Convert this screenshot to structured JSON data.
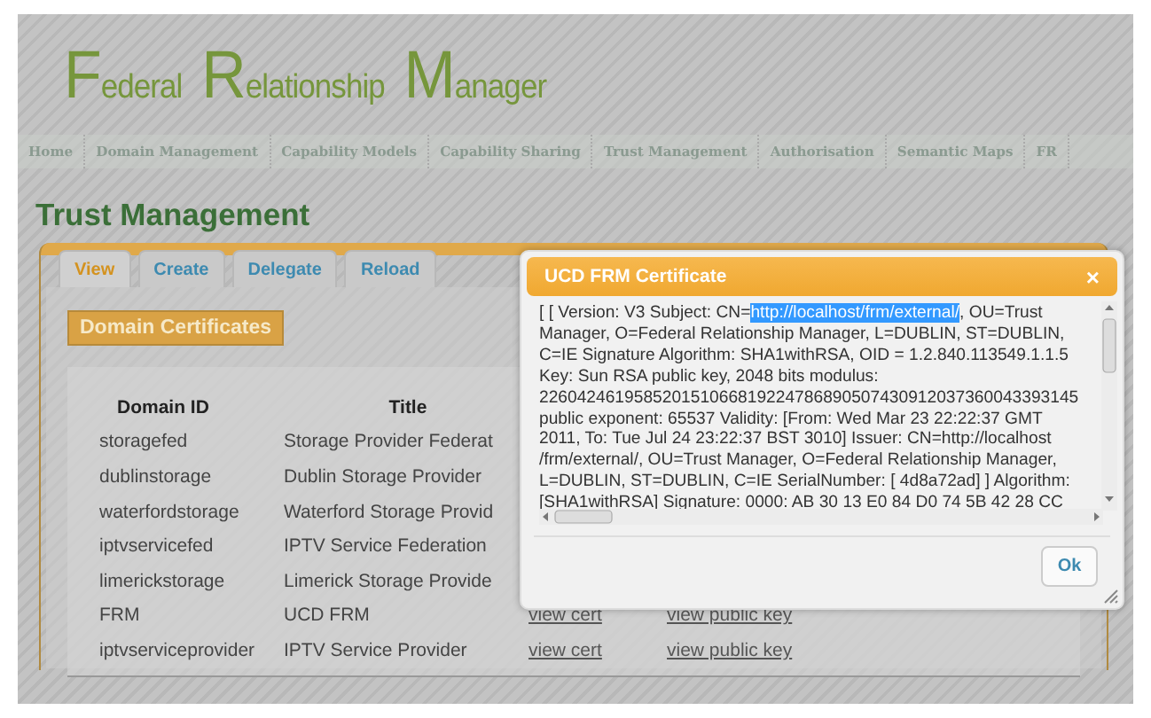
{
  "header": {
    "logo_words": [
      "Federal",
      "Relationship",
      "Manager"
    ]
  },
  "nav": [
    {
      "label": "Home"
    },
    {
      "label": "Domain Management"
    },
    {
      "label": "Capability Models"
    },
    {
      "label": "Capability Sharing"
    },
    {
      "label": "Trust Management"
    },
    {
      "label": "Authorisation"
    },
    {
      "label": "Semantic Maps"
    },
    {
      "label": "FR"
    }
  ],
  "page_title": "Trust Management",
  "tabs": [
    {
      "label": "View",
      "selected": true
    },
    {
      "label": "Create",
      "selected": false
    },
    {
      "label": "Delegate",
      "selected": false
    },
    {
      "label": "Reload",
      "selected": false
    }
  ],
  "section_title": "Domain Certificates",
  "table": {
    "columns": [
      "Domain ID",
      "Title"
    ],
    "rows": [
      {
        "domain_id": "storagefed",
        "title": "Storage Provider Federat",
        "links": []
      },
      {
        "domain_id": "dublinstorage",
        "title": "Dublin Storage Provider",
        "links": []
      },
      {
        "domain_id": "waterfordstorage",
        "title": "Waterford Storage Provid",
        "links": []
      },
      {
        "domain_id": "iptvservicefed",
        "title": "IPTV Service Federation",
        "links": []
      },
      {
        "domain_id": "limerickstorage",
        "title": "Limerick Storage Provide",
        "links": []
      },
      {
        "domain_id": "FRM",
        "title": "UCD FRM",
        "links": [
          "view cert",
          "view public key"
        ]
      },
      {
        "domain_id": "iptvserviceprovider",
        "title": "IPTV Service Provider",
        "links": [
          "view cert",
          "view public key"
        ]
      }
    ]
  },
  "dialog": {
    "title": "UCD FRM Certificate",
    "close": "×",
    "first_line": {
      "before": "[ [ Version: V3 Subject: CN=",
      "selected": "http://localhost/frm/external/",
      "after": ", OU=Trust"
    },
    "lines": [
      "Manager, O=Federal Relationship Manager, L=DUBLIN, ST=DUBLIN,",
      "C=IE Signature Algorithm: SHA1withRSA, OID = 1.2.840.113549.1.1.5",
      "Key: Sun RSA public key, 2048 bits modulus:",
      "226042461958520151066819224786890507430912037360043393145",
      "public exponent: 65537 Validity: [From: Wed Mar 23 22:22:37 GMT",
      "2011, To: Tue Jul 24 23:22:37 BST 3010] Issuer: CN=http://localhost",
      "/frm/external/, OU=Trust Manager, O=Federal Relationship Manager,",
      "L=DUBLIN, ST=DUBLIN, C=IE SerialNumber: [ 4d8a72ad] ] Algorithm:",
      "[SHA1withRSA] Signature: 0000: AB 30 13 E0 84 D0 74 5B 42 28 CC"
    ],
    "ok": "Ok"
  }
}
